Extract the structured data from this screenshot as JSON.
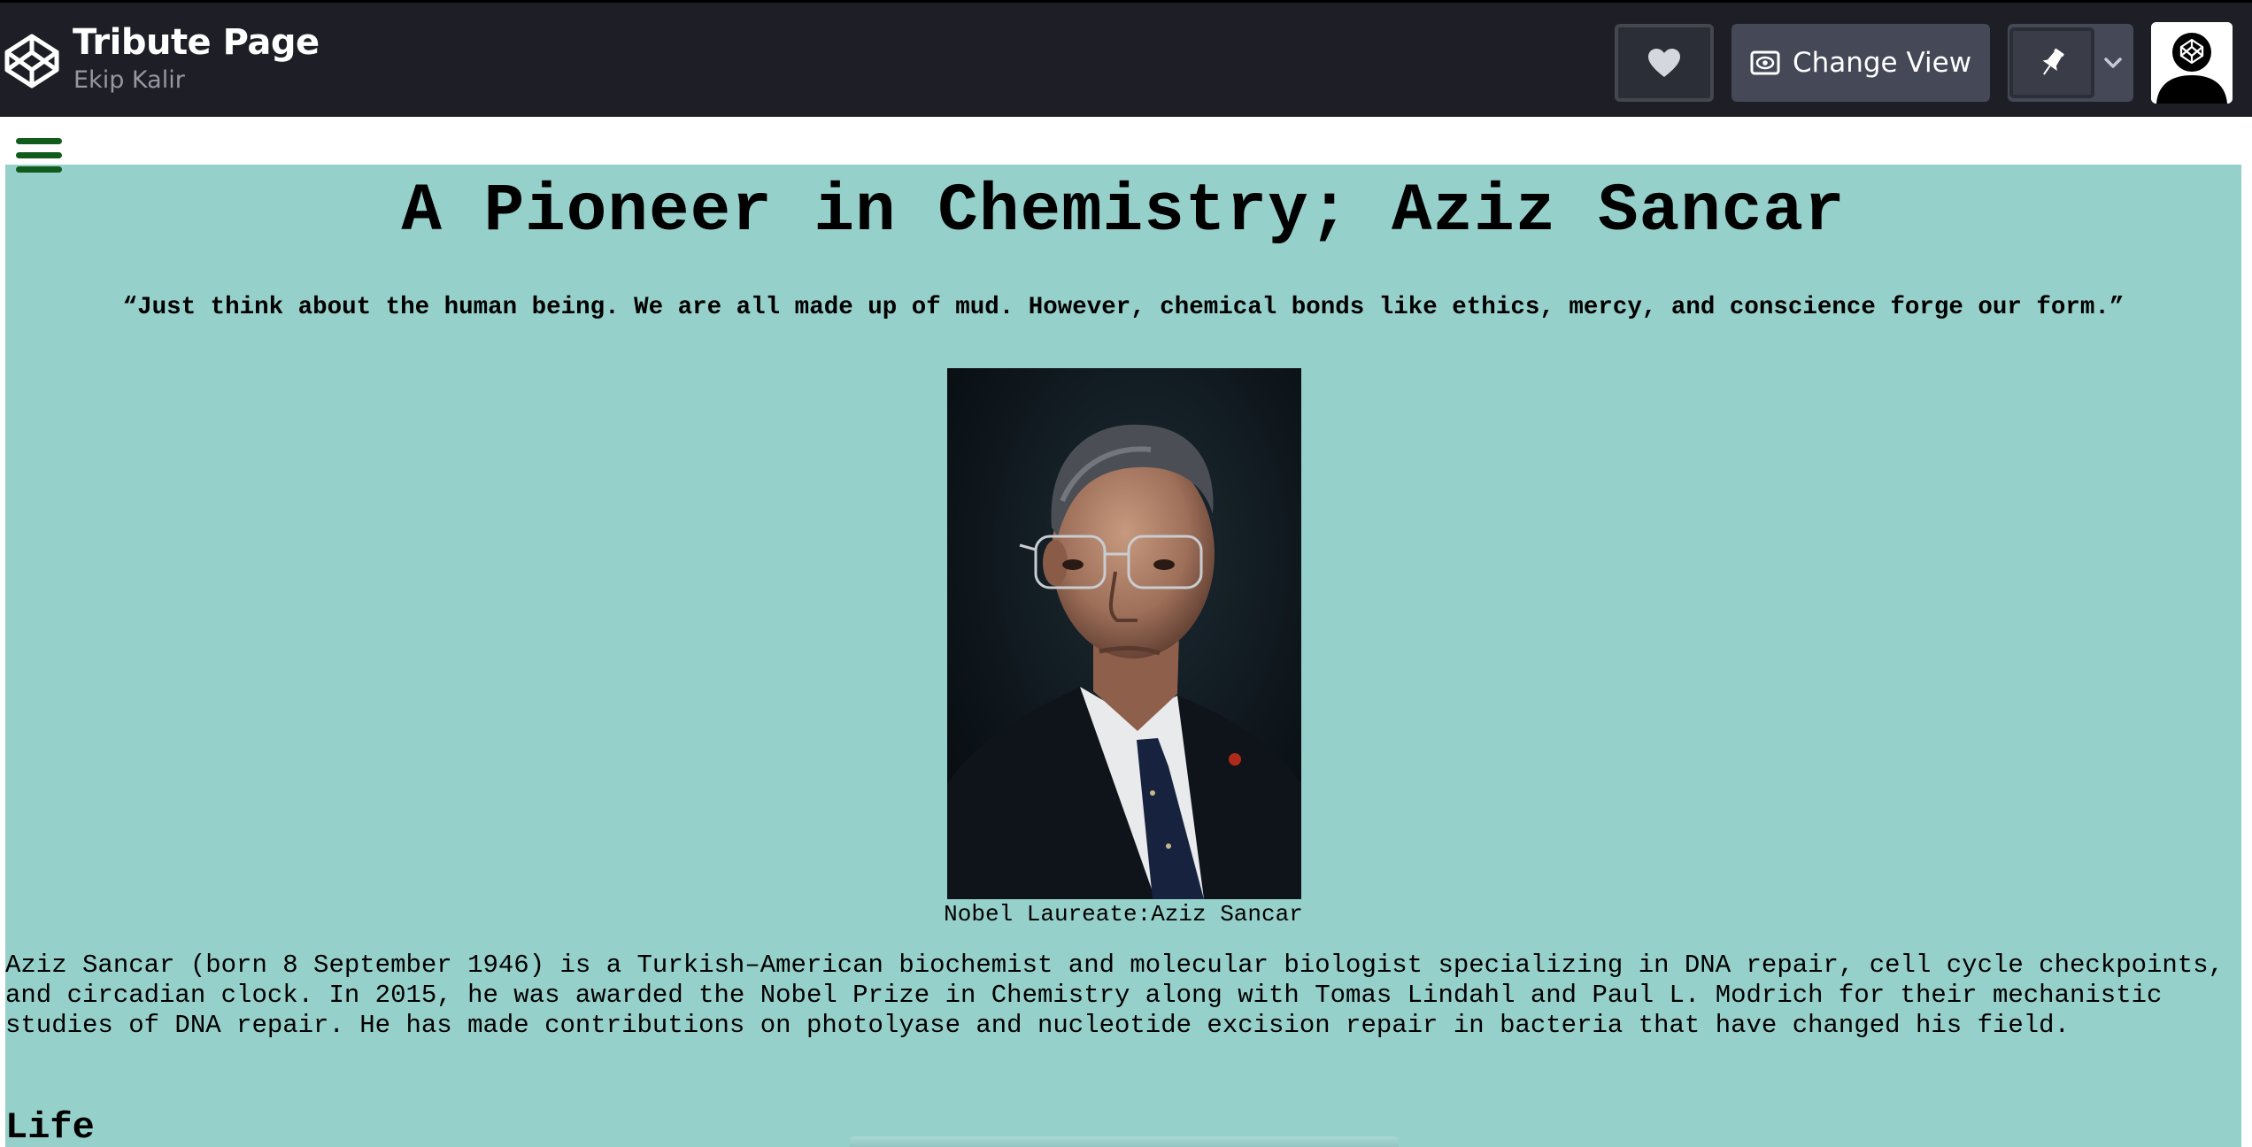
{
  "header": {
    "title": "Tribute Page",
    "author": "Ekip Kalir",
    "change_view_label": "Change View",
    "icons": [
      "codepen-logo-icon",
      "heart-icon",
      "eye-icon",
      "pin-icon",
      "chevron-down-icon",
      "user-avatar"
    ],
    "colors": {
      "bar": "#1e1f26",
      "button": "#444857",
      "accent_text": "#ffffff",
      "muted_text": "#9597a2"
    }
  },
  "page": {
    "background": "#96d0cb",
    "menu_icon": "hamburger-icon",
    "menu_color": "#0f5c1c",
    "heading": "A Pioneer in Chemistry; Aziz Sancar",
    "quote": "“Just think about the human being. We are all made up of mud. However, chemical bonds like ethics, mercy, and conscience forge our form.”",
    "image_caption": "Nobel Laureate:Aziz Sancar",
    "bio": "Aziz Sancar (born 8 September 1946) is a Turkish–American biochemist and molecular biologist specializing in DNA repair, cell cycle checkpoints, and circadian clock. In 2015, he was awarded the Nobel Prize in Chemistry along with Tomas Lindahl and Paul L. Modrich for their mechanistic studies of DNA repair. He has made contributions on photolyase and nucleotide excision repair in bacteria that have changed his field.",
    "section_life": "Life"
  }
}
